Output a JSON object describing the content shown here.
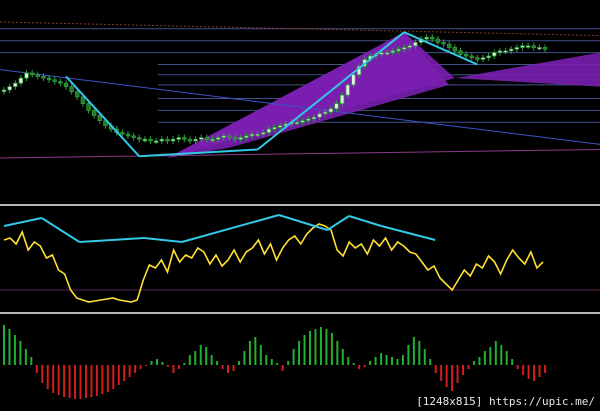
{
  "watermark": {
    "text": "[1248x815] https://upic.me/"
  },
  "colors": {
    "background": "#000000",
    "candle_bull": "#2e9e3a",
    "candle_bull_fill": "#e8f0e8",
    "candle_bear": "#1f7a2a",
    "channel_fill": "#7a1fb0",
    "level_lines": "#5a6fb8",
    "dotted_resistance": "#8a3a2a",
    "trend_line": "#3a55c8",
    "purple_line": "#8a3a8a",
    "zigzag": "#33c8e8",
    "oscillator": "#ffe033",
    "hist_positive": "#22b02e",
    "hist_negative": "#d21e1e",
    "separator": "#b8b8b8"
  },
  "chart_data": [
    {
      "type": "candlestick",
      "panel": "price",
      "grid": false,
      "ylim": [
        0,
        100
      ],
      "closes": [
        60,
        62,
        64,
        67,
        70,
        69,
        68,
        67,
        66,
        65,
        64,
        62,
        59,
        56,
        52,
        48,
        45,
        42,
        39,
        37,
        35,
        34,
        33,
        32,
        31,
        31,
        30,
        30,
        31,
        30,
        31,
        32,
        31,
        30,
        31,
        32,
        31,
        31,
        32,
        33,
        32,
        31,
        32,
        33,
        34,
        34,
        35,
        37,
        38,
        39,
        40,
        41,
        41,
        42,
        43,
        44,
        46,
        47,
        49,
        52,
        57,
        63,
        69,
        74,
        78,
        80,
        81,
        82,
        82,
        83,
        84,
        85,
        86,
        88,
        90,
        91,
        90,
        88,
        87,
        85,
        83,
        81,
        80,
        79,
        78,
        79,
        80,
        82,
        83,
        83,
        84,
        85,
        86,
        86,
        85,
        85,
        84
      ],
      "horizontal_levels": [
        96,
        89,
        82,
        75,
        69,
        63,
        55,
        48,
        41
      ],
      "trend_lines": [
        {
          "name": "descending",
          "from": [
            0,
            72
          ],
          "to": [
            96,
            28
          ]
        },
        {
          "name": "dotted-resistance",
          "from": [
            0,
            100
          ],
          "to": [
            96,
            92
          ]
        },
        {
          "name": "support",
          "from": [
            0,
            20
          ],
          "to": [
            96,
            25
          ]
        }
      ],
      "channel": {
        "from": [
          29,
          20
        ],
        "to_top": [
          96,
          82
        ],
        "to_bottom": [
          96,
          62
        ],
        "peak": [
          71,
          94
        ]
      },
      "zigzag": [
        [
          11,
          68
        ],
        [
          24,
          21
        ],
        [
          29,
          22
        ],
        [
          45,
          25
        ],
        [
          71,
          94
        ],
        [
          84,
          75
        ]
      ]
    },
    {
      "type": "line",
      "panel": "oscillator",
      "ylim": [
        0,
        100
      ],
      "values": [
        70,
        72,
        66,
        78,
        60,
        68,
        64,
        52,
        55,
        40,
        36,
        20,
        12,
        10,
        8,
        9,
        10,
        11,
        12,
        10,
        9,
        8,
        10,
        30,
        45,
        42,
        50,
        38,
        60,
        48,
        55,
        52,
        62,
        58,
        46,
        55,
        44,
        50,
        60,
        48,
        58,
        62,
        70,
        56,
        66,
        50,
        62,
        70,
        74,
        66,
        76,
        82,
        86,
        84,
        80,
        60,
        54,
        68,
        62,
        66,
        56,
        70,
        64,
        72,
        60,
        68,
        64,
        58,
        56,
        48,
        40,
        44,
        32,
        26,
        20,
        30,
        40,
        34,
        46,
        42,
        54,
        48,
        36,
        50,
        60,
        52,
        46,
        58,
        42,
        48
      ],
      "zigzag": [
        [
          0,
          84
        ],
        [
          7,
          92
        ],
        [
          14,
          68
        ],
        [
          26,
          72
        ],
        [
          33,
          68
        ],
        [
          51,
          95
        ],
        [
          60,
          80
        ],
        [
          64,
          94
        ],
        [
          70,
          84
        ],
        [
          80,
          70
        ]
      ]
    },
    {
      "type": "bar",
      "panel": "histogram",
      "ylim": [
        -40,
        45
      ],
      "values": [
        40,
        36,
        30,
        24,
        16,
        8,
        -8,
        -18,
        -24,
        -28,
        -30,
        -32,
        -33,
        -34,
        -34,
        -33,
        -32,
        -31,
        -29,
        -27,
        -24,
        -20,
        -16,
        -12,
        -8,
        -4,
        -1,
        4,
        6,
        3,
        -2,
        -8,
        -4,
        2,
        10,
        14,
        20,
        18,
        10,
        4,
        -4,
        -8,
        -6,
        4,
        14,
        24,
        28,
        20,
        10,
        6,
        2,
        -6,
        4,
        16,
        24,
        30,
        34,
        36,
        38,
        36,
        32,
        24,
        16,
        8,
        2,
        -4,
        -2,
        4,
        8,
        12,
        10,
        8,
        6,
        10,
        20,
        28,
        24,
        16,
        6,
        -8,
        -16,
        -22,
        -26,
        -18,
        -10,
        -4,
        4,
        8,
        14,
        18,
        24,
        20,
        14,
        6,
        -4,
        -10,
        -14,
        -16,
        -12,
        -8
      ]
    }
  ]
}
